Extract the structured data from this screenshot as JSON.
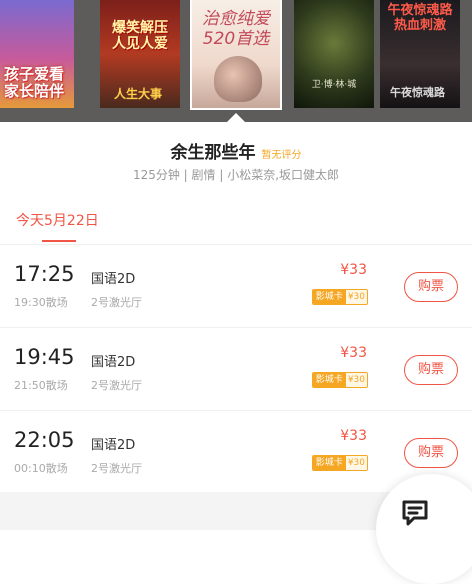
{
  "posters": [
    {
      "text": "孩子爱看\n家长陪伴"
    },
    {
      "text": "爆笑解压\n人见人爱",
      "subtext": "人生大事"
    },
    {
      "text": "治愈纯爱\n520首选",
      "selected": true
    },
    {
      "text": "卫·博·林·城"
    },
    {
      "text": "午夜惊魂路\n热血刺激",
      "subtext": "午夜惊魂路"
    }
  ],
  "movie": {
    "title": "余生那些年",
    "rating": "暂无评分",
    "meta": "125分钟 | 剧情 | 小松菜奈,坂口健太郎"
  },
  "date_tab": "今天5月22日",
  "showtimes": [
    {
      "time": "17:25",
      "end": "19:30散场",
      "lang": "国语2D",
      "hall": "2号激光厅",
      "price": "¥33",
      "card_label": "影城卡",
      "card_price": "¥30",
      "buy": "购票"
    },
    {
      "time": "19:45",
      "end": "21:50散场",
      "lang": "国语2D",
      "hall": "2号激光厅",
      "price": "¥33",
      "card_label": "影城卡",
      "card_price": "¥30",
      "buy": "购票"
    },
    {
      "time": "22:05",
      "end": "00:10散场",
      "lang": "国语2D",
      "hall": "2号激光厅",
      "price": "¥33",
      "card_label": "影城卡",
      "card_price": "¥30",
      "buy": "购票"
    }
  ],
  "colors": {
    "accent": "#f05545",
    "card": "#f5a623"
  },
  "icons": {
    "fab": "edit-note-icon"
  }
}
